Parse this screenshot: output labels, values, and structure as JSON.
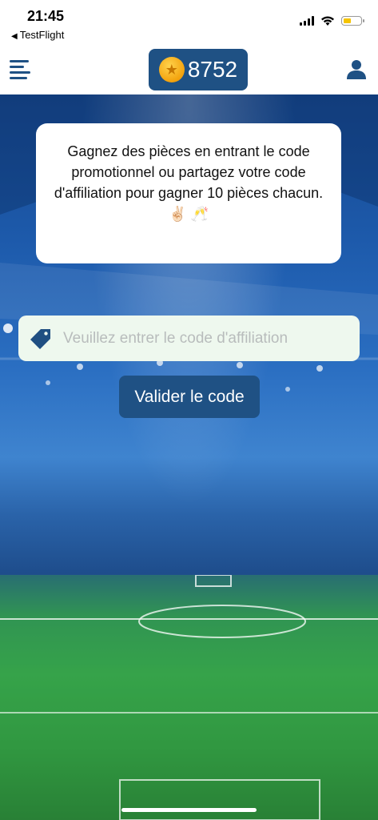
{
  "status_bar": {
    "time": "21:45",
    "back_app": "TestFlight",
    "battery_color": "#f5c400"
  },
  "header": {
    "menu_icon": "hamburger-menu-icon",
    "coin_icon": "gold-coin-star-icon",
    "coins": "8752",
    "user_icon": "user-profile-icon",
    "accent": "#1f5184"
  },
  "promo": {
    "message": "Gagnez des pièces en entrant le code promotionnel ou partagez votre code d'affiliation pour gagner 10 pièces chacun. ✌🏻 🥂"
  },
  "affiliation": {
    "input_icon": "tag-icon",
    "placeholder": "Veuillez entrer le code d'affiliation",
    "value": "",
    "submit_label": "Valider le code"
  },
  "background": {
    "scene": "football-stadium"
  }
}
